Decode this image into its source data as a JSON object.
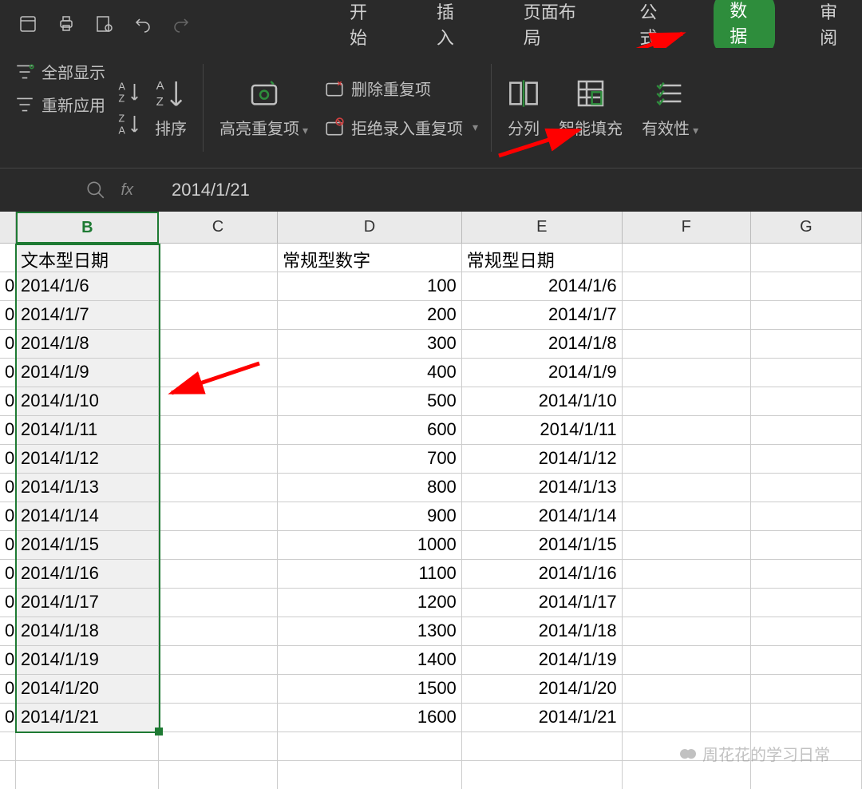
{
  "titlebar": {},
  "tabs": [
    "开始",
    "插入",
    "页面布局",
    "公式",
    "数据",
    "审阅"
  ],
  "active_tab_index": 4,
  "ribbon": {
    "show_all": "全部显示",
    "reapply": "重新应用",
    "sort": "排序",
    "highlight_dup": "高亮重复项",
    "remove_dup": "删除重复项",
    "reject_dup": "拒绝录入重复项",
    "text_to_col": "分列",
    "smart_fill": "智能填充",
    "validation": "有效性"
  },
  "formula_bar": {
    "value": "2014/1/21"
  },
  "columns": [
    "B",
    "C",
    "D",
    "E",
    "F",
    "G"
  ],
  "headers": {
    "B": "文本型日期",
    "D": "常规型数字",
    "E": "常规型日期"
  },
  "rows": [
    {
      "A": "0",
      "B": "2014/1/6",
      "D": "100",
      "E": "2014/1/6"
    },
    {
      "A": "0",
      "B": "2014/1/7",
      "D": "200",
      "E": "2014/1/7"
    },
    {
      "A": "0",
      "B": "2014/1/8",
      "D": "300",
      "E": "2014/1/8"
    },
    {
      "A": "0",
      "B": "2014/1/9",
      "D": "400",
      "E": "2014/1/9"
    },
    {
      "A": "0",
      "B": "2014/1/10",
      "D": "500",
      "E": "2014/1/10"
    },
    {
      "A": "0",
      "B": "2014/1/11",
      "D": "600",
      "E": "2014/1/11"
    },
    {
      "A": "0",
      "B": "2014/1/12",
      "D": "700",
      "E": "2014/1/12"
    },
    {
      "A": "0",
      "B": "2014/1/13",
      "D": "800",
      "E": "2014/1/13"
    },
    {
      "A": "0",
      "B": "2014/1/14",
      "D": "900",
      "E": "2014/1/14"
    },
    {
      "A": "0",
      "B": "2014/1/15",
      "D": "1000",
      "E": "2014/1/15"
    },
    {
      "A": "0",
      "B": "2014/1/16",
      "D": "1100",
      "E": "2014/1/16"
    },
    {
      "A": "0",
      "B": "2014/1/17",
      "D": "1200",
      "E": "2014/1/17"
    },
    {
      "A": "0",
      "B": "2014/1/18",
      "D": "1300",
      "E": "2014/1/18"
    },
    {
      "A": "0",
      "B": "2014/1/19",
      "D": "1400",
      "E": "2014/1/19"
    },
    {
      "A": "0",
      "B": "2014/1/20",
      "D": "1500",
      "E": "2014/1/20"
    },
    {
      "A": "0",
      "B": "2014/1/21",
      "D": "1600",
      "E": "2014/1/21"
    }
  ],
  "watermark": "周花花的学习日常"
}
